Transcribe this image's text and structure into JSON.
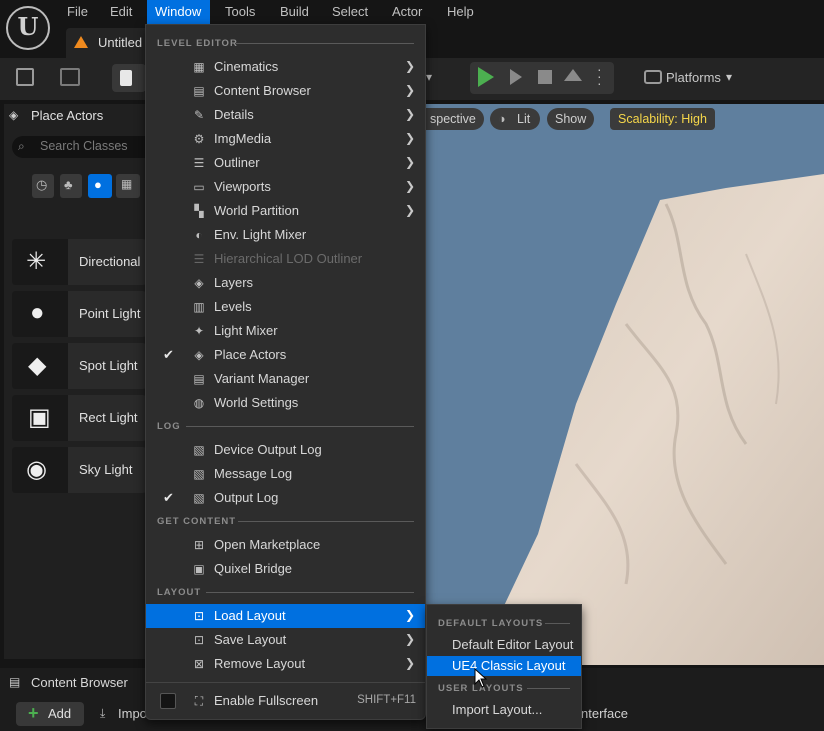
{
  "menubar": {
    "items": [
      "File",
      "Edit",
      "Window",
      "Tools",
      "Build",
      "Select",
      "Actor",
      "Help"
    ],
    "active": "Window"
  },
  "tab": {
    "label": "Untitled"
  },
  "toolbar": {
    "platforms_label": "Platforms"
  },
  "place_actors": {
    "title": "Place Actors",
    "search_placeholder": "Search Classes",
    "items": [
      "Directional",
      "Point Light",
      "Spot Light",
      "Rect Light",
      "Sky Light"
    ]
  },
  "viewport": {
    "perspective_label": "spective",
    "lit_label": "Lit",
    "show_label": "Show",
    "scalability_label": "Scalability: High"
  },
  "bottom": {
    "content_browser_title": "Content Browser",
    "add_label": "Add",
    "import_label": "Impo",
    "interface_label": "nterface"
  },
  "window_menu": {
    "sections": {
      "level_editor": "LEVEL EDITOR",
      "log": "LOG",
      "get_content": "GET CONTENT",
      "layout": "LAYOUT"
    },
    "level_editor_items": [
      {
        "label": "Cinematics",
        "icon": "cinematics-icon",
        "submenu": true
      },
      {
        "label": "Content Browser",
        "icon": "content-browser-icon",
        "submenu": true
      },
      {
        "label": "Details",
        "icon": "details-icon",
        "submenu": true
      },
      {
        "label": "ImgMedia",
        "icon": "imgmedia-icon",
        "submenu": true
      },
      {
        "label": "Outliner",
        "icon": "outliner-icon",
        "submenu": true
      },
      {
        "label": "Viewports",
        "icon": "viewports-icon",
        "submenu": true
      },
      {
        "label": "World Partition",
        "icon": "world-partition-icon",
        "submenu": true
      },
      {
        "label": "Env. Light Mixer",
        "icon": "env-light-mixer-icon"
      },
      {
        "label": "Hierarchical LOD Outliner",
        "icon": "hlod-outliner-icon",
        "disabled": true
      },
      {
        "label": "Layers",
        "icon": "layers-icon"
      },
      {
        "label": "Levels",
        "icon": "levels-icon"
      },
      {
        "label": "Light Mixer",
        "icon": "light-mixer-icon"
      },
      {
        "label": "Place Actors",
        "icon": "place-actors-icon",
        "checked": true
      },
      {
        "label": "Variant Manager",
        "icon": "variant-manager-icon"
      },
      {
        "label": "World Settings",
        "icon": "world-settings-icon"
      }
    ],
    "log_items": [
      {
        "label": "Device Output Log",
        "icon": "device-output-log-icon"
      },
      {
        "label": "Message Log",
        "icon": "message-log-icon"
      },
      {
        "label": "Output Log",
        "icon": "output-log-icon",
        "checked": true
      }
    ],
    "get_content_items": [
      {
        "label": "Open Marketplace",
        "icon": "marketplace-icon"
      },
      {
        "label": "Quixel Bridge",
        "icon": "quixel-bridge-icon"
      }
    ],
    "layout_items": [
      {
        "label": "Load Layout",
        "icon": "load-layout-icon",
        "submenu": true,
        "highlighted": true
      },
      {
        "label": "Save Layout",
        "icon": "save-layout-icon",
        "submenu": true
      },
      {
        "label": "Remove Layout",
        "icon": "remove-layout-icon",
        "submenu": true
      }
    ],
    "fullscreen": {
      "label": "Enable Fullscreen",
      "shortcut": "SHIFT+F11"
    }
  },
  "load_layout_submenu": {
    "default_header": "DEFAULT LAYOUTS",
    "user_header": "USER LAYOUTS",
    "items": [
      "Default Editor Layout",
      "UE4 Classic Layout"
    ],
    "import_label": "Import Layout..."
  },
  "colors": {
    "accent": "#0070e0",
    "scalability": "#f5d64a",
    "play_green": "#4caf50"
  }
}
